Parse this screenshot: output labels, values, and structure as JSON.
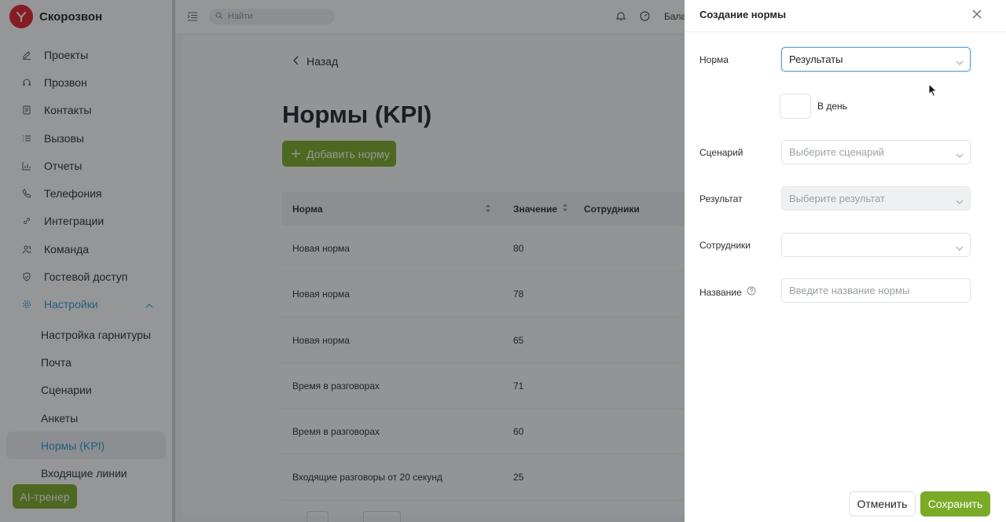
{
  "app": {
    "name": "Скорозвон"
  },
  "sidebar": {
    "items": [
      {
        "label": "Проекты",
        "icon": "pencil-icon"
      },
      {
        "label": "Прозвон",
        "icon": "headset-icon"
      },
      {
        "label": "Контакты",
        "icon": "contacts-icon"
      },
      {
        "label": "Вызовы",
        "icon": "list-icon"
      },
      {
        "label": "Отчеты",
        "icon": "chart-icon"
      },
      {
        "label": "Телефония",
        "icon": "phone-icon"
      },
      {
        "label": "Интеграции",
        "icon": "link-icon"
      },
      {
        "label": "Команда",
        "icon": "team-icon"
      },
      {
        "label": "Гостевой доступ",
        "icon": "shield-icon"
      },
      {
        "label": "Настройки",
        "icon": "gear-icon",
        "active": true
      }
    ],
    "subitems": [
      {
        "label": "Настройка гарнитуры"
      },
      {
        "label": "Почта"
      },
      {
        "label": "Сценарии"
      },
      {
        "label": "Анкеты"
      },
      {
        "label": "Нормы (KPI)",
        "active": true
      },
      {
        "label": "Входящие линии"
      }
    ],
    "ai_button": "AI-тренер"
  },
  "topbar": {
    "search_placeholder": "Найти",
    "balance_label": "Бала"
  },
  "main": {
    "back_label": "Назад",
    "title": "Нормы (KPI)",
    "add_button": "Добавить норму",
    "table": {
      "headers": [
        "Норма",
        "Значение",
        "Сотрудники"
      ],
      "rows": [
        {
          "name": "Новая норма",
          "value": "80"
        },
        {
          "name": "Новая норма",
          "value": "78"
        },
        {
          "name": "Новая норма",
          "value": "65"
        },
        {
          "name": "Время в разговорах",
          "value": "71"
        },
        {
          "name": "Время в разговорах",
          "value": "60"
        },
        {
          "name": "Входящие разговоры от 20 секунд",
          "value": "25"
        }
      ]
    }
  },
  "panel": {
    "title": "Создание нормы",
    "fields": {
      "norm": {
        "label": "Норма",
        "value": "Результаты"
      },
      "per_day": {
        "label": "В день",
        "value": ""
      },
      "scenario": {
        "label": "Сценарий",
        "placeholder": "Выберите сценарий"
      },
      "result": {
        "label": "Результат",
        "placeholder": "Выберите результат"
      },
      "employees": {
        "label": "Сотрудники",
        "value": ""
      },
      "name": {
        "label": "Название",
        "placeholder": "Введите название нормы"
      }
    },
    "cancel_button": "Отменить",
    "save_button": "Сохранить"
  },
  "colors": {
    "accent_green": "#7aab27",
    "accent_blue": "#2f9bd6",
    "brand_red": "#e3232c"
  }
}
